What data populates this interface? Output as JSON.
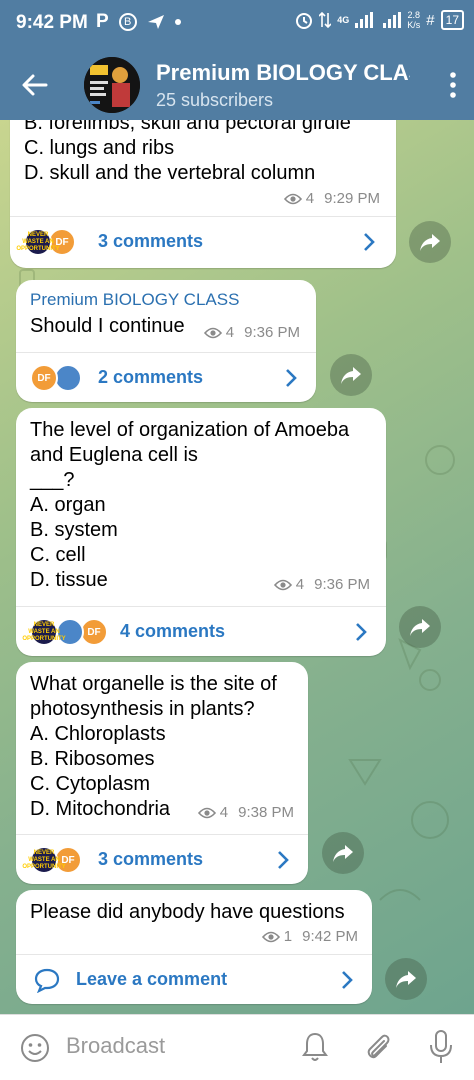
{
  "status_bar": {
    "time": "9:42 PM",
    "left_icons": [
      "p-icon",
      "b-icon",
      "send-icon",
      "dot-icon"
    ],
    "right_text": "4G",
    "speed": "2.8",
    "speed_unit": "K/s",
    "battery": "17"
  },
  "header": {
    "title": "Premium BIOLOGY CLASS",
    "subscribers": "25 subscribers"
  },
  "messages": [
    {
      "text": "B. forelimbs, skull and pectoral girdle\nC. lungs and ribs\nD. skull and the vertebral column",
      "views": "4",
      "time": "9:29 PM",
      "comments": "3 comments"
    },
    {
      "sender": "Premium BIOLOGY CLASS",
      "text": "Should I continue",
      "views": "4",
      "time": "9:36 PM",
      "comments": "2 comments"
    },
    {
      "text": "The level of organization of Amoeba\nand Euglena cell is\n___?\nA. organ\nB. system\nC. cell\nD. tissue",
      "views": "4",
      "time": "9:36 PM",
      "comments": "4 comments"
    },
    {
      "text": "What organelle is the site of\nphotosynthesis in plants?\nA. Chloroplasts\nB. Ribosomes\nC. Cytoplasm\nD. Mitochondria",
      "views": "4",
      "time": "9:38 PM",
      "comments": "3 comments"
    },
    {
      "text": "Please did anybody have questions",
      "views": "1",
      "time": "9:42 PM",
      "comments": "Leave a comment"
    }
  ],
  "avatar_labels": {
    "never": "NEVER\nWASTE AN\nOPPORTUNITY",
    "df": "DF"
  },
  "bottom_bar": {
    "placeholder": "Broadcast"
  },
  "colors": {
    "header_bg": "#517da2",
    "link": "#2b78c2",
    "sender": "#2b70b0"
  }
}
